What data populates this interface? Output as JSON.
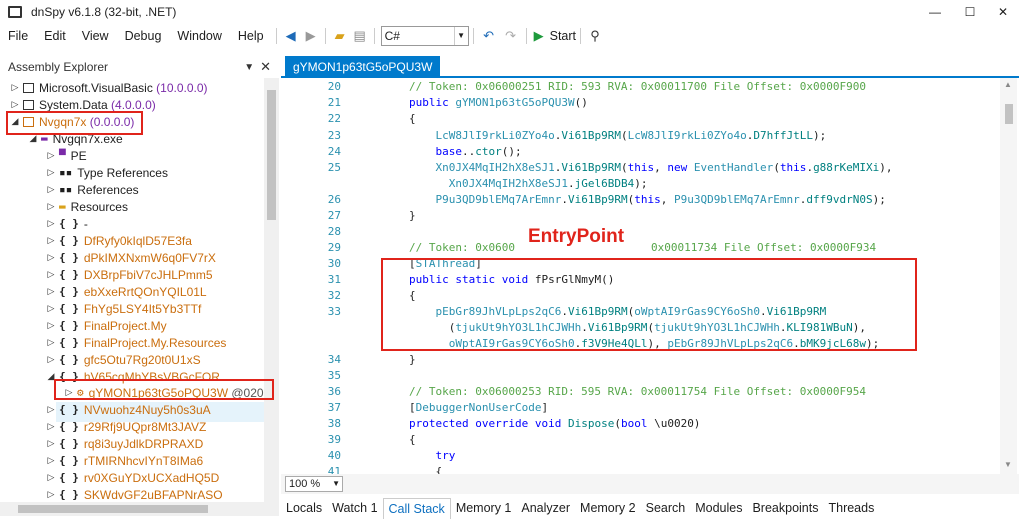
{
  "app": {
    "title": "dnSpy v6.1.8 (32-bit, .NET)"
  },
  "window_controls": {
    "minimize": "—",
    "maximize": "☐",
    "close": "✕"
  },
  "menu": [
    "File",
    "Edit",
    "View",
    "Debug",
    "Window",
    "Help"
  ],
  "toolbar": {
    "language": "C#",
    "start_label": "Start"
  },
  "assembly_explorer": {
    "title": "Assembly Explorer",
    "items": [
      {
        "label": "Microsoft.VisualBasic",
        "version": "(10.0.0.0)"
      },
      {
        "label": "System.Data",
        "version": "(4.0.0.0)"
      },
      {
        "label": "Nvgqn7x",
        "version": "(0.0.0.0)"
      },
      {
        "label": "Nvgqn7x.exe"
      },
      {
        "label": "PE"
      },
      {
        "label": "Type References"
      },
      {
        "label": "References"
      },
      {
        "label": "Resources"
      },
      {
        "label": "-"
      },
      {
        "label": "DfRyfy0kIqlD57E3fa"
      },
      {
        "label": "dPkIMXNxmW6q0FV7rX"
      },
      {
        "label": "DXBrpFbiV7cJHLPmm5"
      },
      {
        "label": "ebXxeRrtQOnYQIL01L"
      },
      {
        "label": "FhYg5LSY4It5Yb3TTf"
      },
      {
        "label": "FinalProject.My"
      },
      {
        "label": "FinalProject.My.Resources"
      },
      {
        "label": "gfc5Otu7Rg20t0U1xS"
      },
      {
        "label": "hV65cqMhYBsVBGcFOR"
      },
      {
        "label": "gYMON1p63tG5oPQU3W",
        "suffix": "@020"
      },
      {
        "label": "NVwuohz4Nuy5h0s3uA"
      },
      {
        "label": "r29Rfj9UQpr8Mt3JAVZ"
      },
      {
        "label": "rq8i3uyJdlkDRPRAXD"
      },
      {
        "label": "rTMIRNhcvIYnT8IMa6"
      },
      {
        "label": "rv0XGuYDxUCXadHQ5D"
      },
      {
        "label": "SKWdvGF2uBFAPNrASO"
      }
    ]
  },
  "editor": {
    "tab": "gYMON1p63tG5oPQU3W",
    "zoom": "100 %",
    "annotation": "EntryPoint",
    "lines": [
      {
        "n": "20",
        "t": "// Token: 0x06000251 RID: 593 RVA: 0x00011700 File Offset: 0x0000F900"
      },
      {
        "n": "21",
        "t": "public gYMON1p63tG5oPQU3W()"
      },
      {
        "n": "22",
        "t": "{"
      },
      {
        "n": "23",
        "t": "    LcW8JlI9rkLi0ZYo4o.Vi61Bp9RM(LcW8JlI9rkLi0ZYo4o.D7hffJtLL);"
      },
      {
        "n": "24",
        "t": "    base..ctor();"
      },
      {
        "n": "25",
        "t": "    Xn0JX4MqIH2hX8eSJ1.Vi61Bp9RM(this, new EventHandler(this.g88rKeMIXi),"
      },
      {
        "n": "",
        "t": "      Xn0JX4MqIH2hX8eSJ1.jGel6BDB4);"
      },
      {
        "n": "26",
        "t": "    P9u3QD9blEMq7ArEmnr.Vi61Bp9RM(this, P9u3QD9blEMq7ArEmnr.dff9vdrN0S);"
      },
      {
        "n": "27",
        "t": "}"
      },
      {
        "n": "28",
        "t": ""
      },
      {
        "n": "29",
        "t": "// Token: 0x0600"
      },
      {
        "n": "29b",
        "t": "0x00011734 File Offset: 0x0000F934"
      },
      {
        "n": "30",
        "t": "[STAThread]"
      },
      {
        "n": "31",
        "t": "public static void fPsrGlNmyM()"
      },
      {
        "n": "32",
        "t": "{"
      },
      {
        "n": "33",
        "t": "    pEbGr89JhVLpLps2qC6.Vi61Bp9RM(oWptAI9rGas9CY6oSh0.Vi61Bp9RM"
      },
      {
        "n": "",
        "t": "      (tjukUt9hYO3L1hCJWHh.Vi61Bp9RM(tjukUt9hYO3L1hCJWHh.KLI981WBuN),"
      },
      {
        "n": "",
        "t": "      oWptAI9rGas9CY6oSh0.f3V9He4QLl), pEbGr89JhVLpLps2qC6.bMK9jcL68w);"
      },
      {
        "n": "34",
        "t": "}"
      },
      {
        "n": "35",
        "t": ""
      },
      {
        "n": "36",
        "t": "// Token: 0x06000253 RID: 595 RVA: 0x00011754 File Offset: 0x0000F954"
      },
      {
        "n": "37",
        "t": "[DebuggerNonUserCode]"
      },
      {
        "n": "38",
        "t": "protected override void Dispose(bool \\u0020)"
      },
      {
        "n": "39",
        "t": "{"
      },
      {
        "n": "40",
        "t": "    try"
      },
      {
        "n": "41",
        "t": "    {"
      },
      {
        "n": "42",
        "t": "        bool flag = \\u0020 && this.j4ErI0mhNT != null;"
      },
      {
        "n": "43",
        "t": "        if (flag)"
      }
    ]
  },
  "bottom_tabs": [
    "Locals",
    "Watch 1",
    "Call Stack",
    "Memory 1",
    "Analyzer",
    "Memory 2",
    "Search",
    "Modules",
    "Breakpoints",
    "Threads"
  ]
}
